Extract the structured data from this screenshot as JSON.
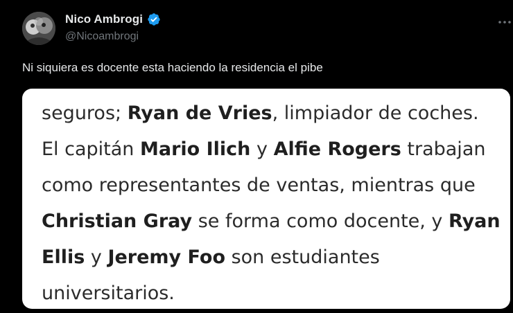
{
  "author": {
    "name": "Nico Ambrogi",
    "handle": "@Nicoambrogi",
    "verified": true
  },
  "menu": {
    "icon": "more-dots-icon"
  },
  "tweet": {
    "text": "Ni siquiera es docente esta haciendo la residencia el pibe"
  },
  "media": {
    "lines": [
      [
        {
          "t": "seguros; ",
          "b": false
        },
        {
          "t": "Ryan de Vries",
          "b": true
        },
        {
          "t": ", limpiador de coches.",
          "b": false
        }
      ],
      [
        {
          "t": "El capitán ",
          "b": false
        },
        {
          "t": "Mario Ilich",
          "b": true
        },
        {
          "t": " y ",
          "b": false
        },
        {
          "t": "Alfie Rogers",
          "b": true
        },
        {
          "t": " trabajan",
          "b": false
        }
      ],
      [
        {
          "t": "como representantes de ventas, mientras que",
          "b": false
        }
      ],
      [
        {
          "t": "Christian Gray",
          "b": true
        },
        {
          "t": " se forma como docente, y ",
          "b": false
        },
        {
          "t": "Ryan",
          "b": true
        }
      ],
      [
        {
          "t": "Ellis",
          "b": true
        },
        {
          "t": " y ",
          "b": false
        },
        {
          "t": "Jeremy Foo",
          "b": true
        },
        {
          "t": " son estudiantes",
          "b": false
        }
      ],
      [
        {
          "t": "universitarios.",
          "b": false
        }
      ]
    ]
  },
  "colors": {
    "background": "#000000",
    "text": "#e7e9ea",
    "secondary": "#71767b",
    "verified": "#1d9bf0"
  }
}
